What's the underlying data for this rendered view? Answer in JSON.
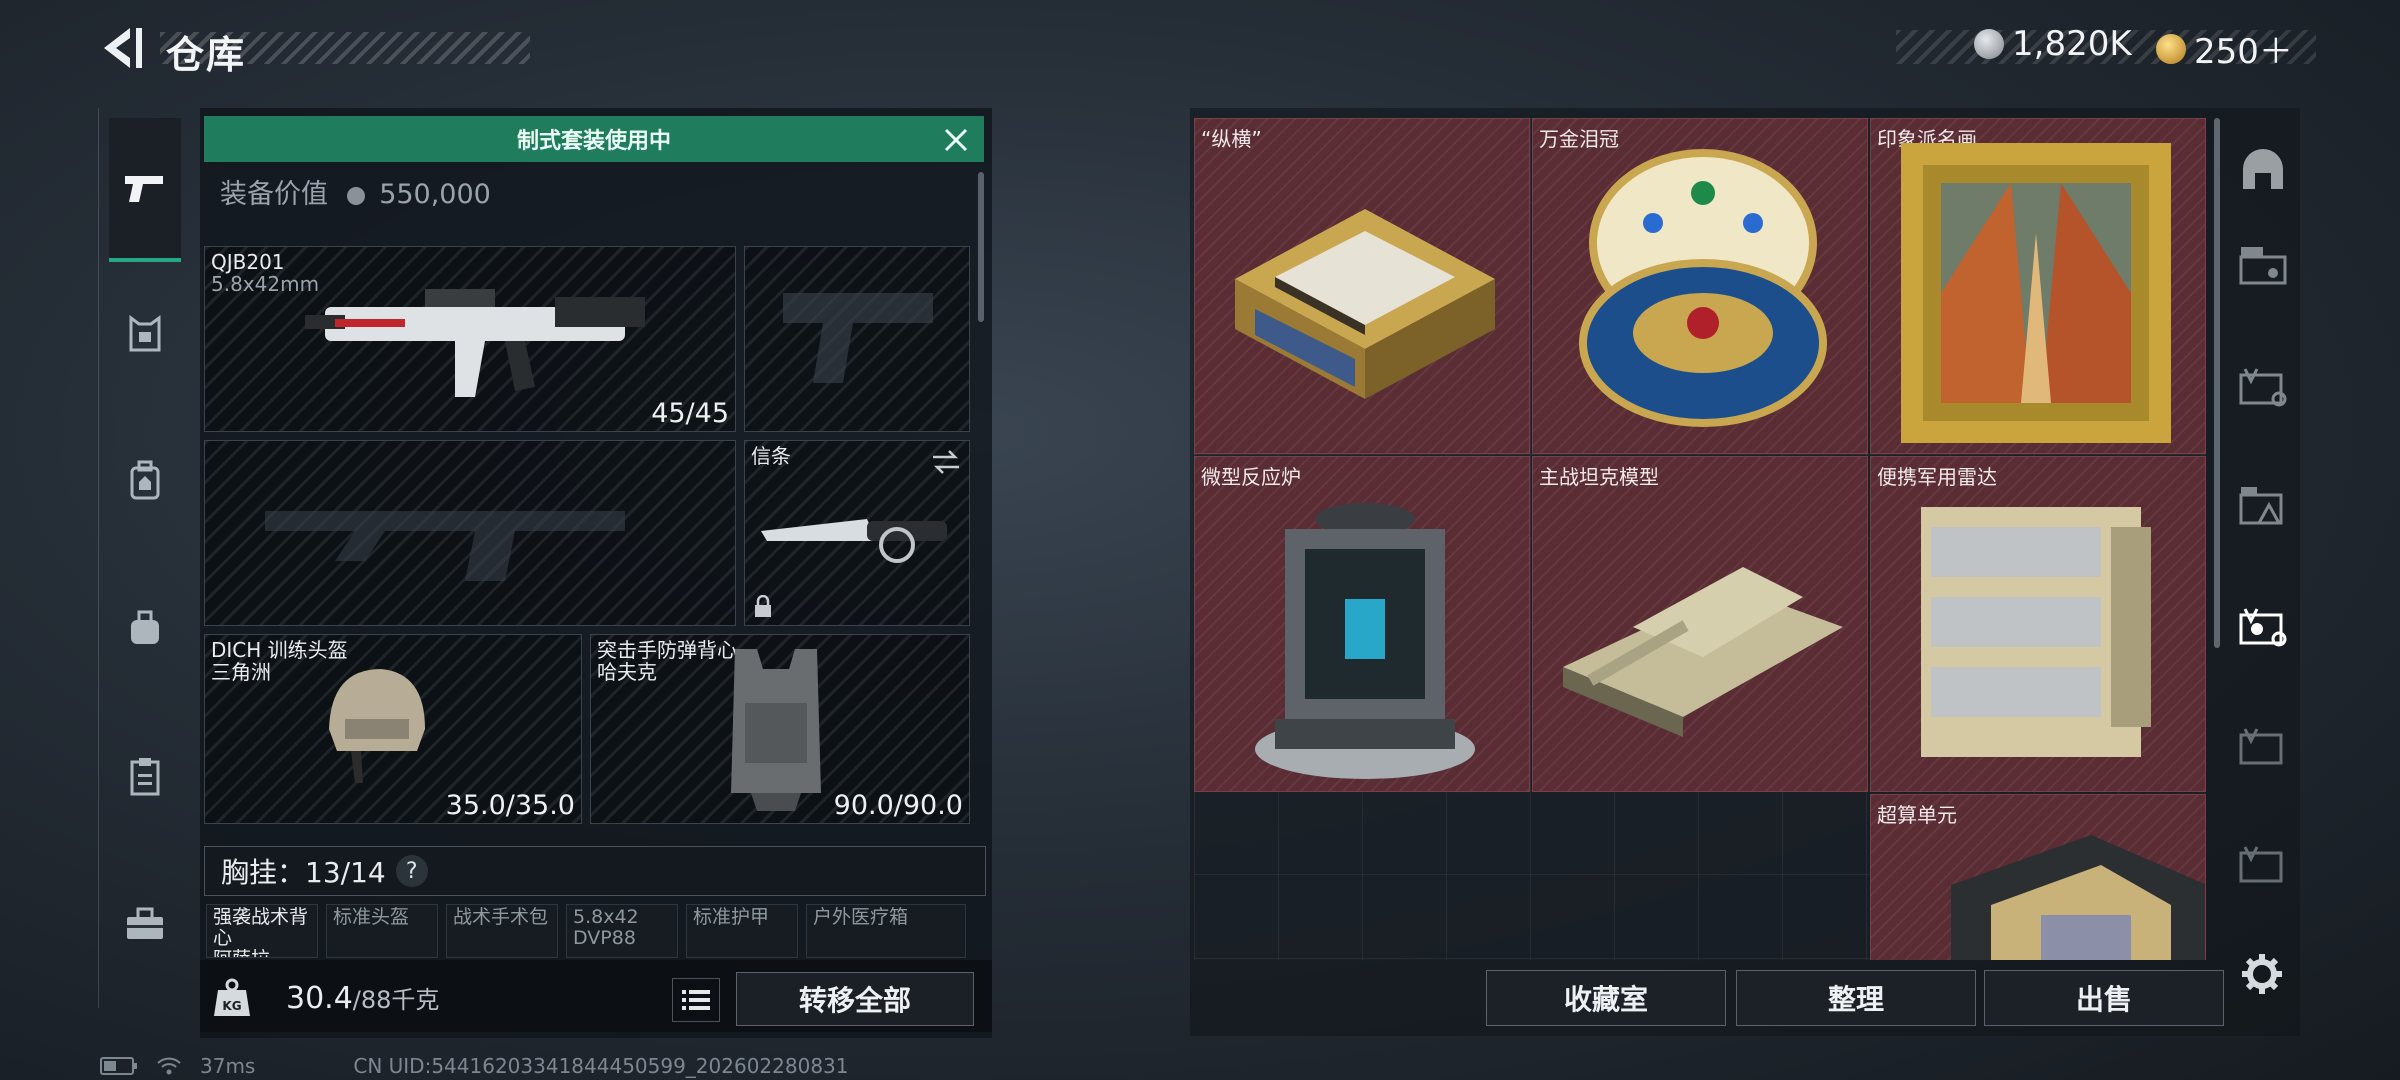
{
  "header": {
    "title": "仓库",
    "currency_1": "1,820K",
    "currency_2": "250＋"
  },
  "left_nav": {
    "items": [
      "gun-icon",
      "armor-icon",
      "backpack-icon",
      "bag-icon",
      "clipboard-icon",
      "toolbox-icon"
    ],
    "active": "gun-icon"
  },
  "loadout": {
    "banner": "制式套装使用中",
    "value_label": "装备价值",
    "value": "550,000",
    "primary": {
      "name": "QJB201",
      "caliber": "5.8x42mm",
      "ammo": "45/45"
    },
    "melee": {
      "name": "信条"
    },
    "helmet": {
      "name": "DICH 训练头盔",
      "sub": "三角洲",
      "durability": "35.0/35.0"
    },
    "armor": {
      "name": "突击手防弹背心",
      "sub": "哈夫克",
      "durability": "90.0/90.0"
    },
    "chest_rig": {
      "label": "胸挂：13/14",
      "help": "?"
    },
    "mini_slots": [
      {
        "name": "强袭战术背心",
        "sub": "阿萨拉"
      },
      {
        "name": "标准头盔",
        "sub": ""
      },
      {
        "name": "战术手术包",
        "sub": ""
      },
      {
        "name": "5.8x42",
        "sub": "DVP88"
      },
      {
        "name": "标准护甲",
        "sub": ""
      },
      {
        "name": "户外医疗箱",
        "sub": ""
      }
    ]
  },
  "footer_left": {
    "weight_current": "30.4",
    "weight_max": "/88千克",
    "transfer_all": "转移全部"
  },
  "storage": {
    "items": [
      {
        "name": "“纵横”"
      },
      {
        "name": "万金泪冠"
      },
      {
        "name": "印象派名画"
      },
      {
        "name": "微型反应炉"
      },
      {
        "name": "主战坦克模型"
      },
      {
        "name": "便携军用雷达"
      },
      {
        "name": "超算单元"
      }
    ],
    "buttons": {
      "collection": "收藏室",
      "organize": "整理",
      "sell": "出售"
    }
  },
  "status_bar": {
    "ping": "37ms",
    "uid": "CN UID:5441620334184445059​9_202602280831"
  },
  "colors": {
    "accent_green": "#1f7c5c",
    "rare_red": "#5a2c33"
  }
}
